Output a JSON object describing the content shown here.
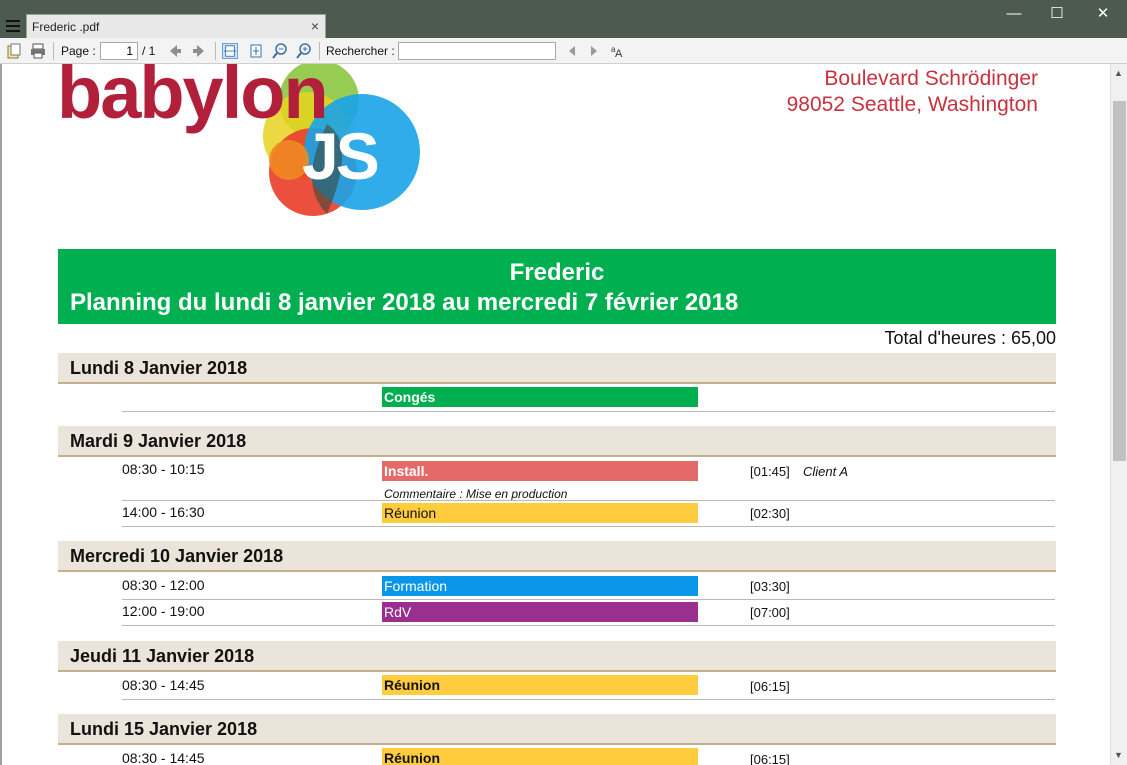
{
  "window": {
    "tab_title": "Frederic .pdf",
    "close_tab": "×",
    "minimize": "—",
    "maximize": "☐",
    "close": "✕"
  },
  "toolbar": {
    "page_label": "Page :",
    "page_value": "1",
    "page_total": "/ 1",
    "search_label": "Rechercher :",
    "search_value": ""
  },
  "document": {
    "logo_text": "babylon",
    "logo_js": "JS",
    "address_line1": "Boulevard Schrödinger",
    "address_line2": "98052 Seattle, Washington",
    "person": "Frederic",
    "title": "Planning du lundi 8 janvier 2018 au mercredi 7 février 2018",
    "total_hours": "Total d'heures : 65,00",
    "colors": {
      "green": "#00b050",
      "red": "#e46a6a",
      "yellow": "#ffcc3d",
      "blue": "#0a96e8",
      "purple": "#9b2f8f"
    },
    "days": [
      {
        "label": "Lundi 8 Janvier 2018",
        "entries": [
          {
            "time": "",
            "activity": "Congés",
            "duration": "",
            "client": "",
            "comment": ""
          }
        ]
      },
      {
        "label": "Mardi 9 Janvier 2018",
        "entries": [
          {
            "time": "08:30 - 10:15",
            "activity": "Install.",
            "duration": "[01:45]",
            "client": "Client A",
            "comment": "Commentaire : Mise en production"
          },
          {
            "time": "14:00 - 16:30",
            "activity": "Réunion",
            "duration": "[02:30]",
            "client": "",
            "comment": ""
          }
        ]
      },
      {
        "label": "Mercredi 10 Janvier 2018",
        "entries": [
          {
            "time": "08:30 - 12:00",
            "activity": "Formation",
            "duration": "[03:30]",
            "client": "",
            "comment": ""
          },
          {
            "time": "12:00 - 19:00",
            "activity": "RdV",
            "duration": "[07:00]",
            "client": "",
            "comment": ""
          }
        ]
      },
      {
        "label": "Jeudi 11 Janvier 2018",
        "entries": [
          {
            "time": "08:30 - 14:45",
            "activity": "Réunion",
            "duration": "[06:15]",
            "client": "",
            "comment": ""
          }
        ]
      },
      {
        "label": "Lundi 15 Janvier 2018",
        "entries": [
          {
            "time": "08:30 - 14:45",
            "activity": "Réunion",
            "duration": "[06:15]",
            "client": "",
            "comment": ""
          }
        ]
      }
    ]
  }
}
